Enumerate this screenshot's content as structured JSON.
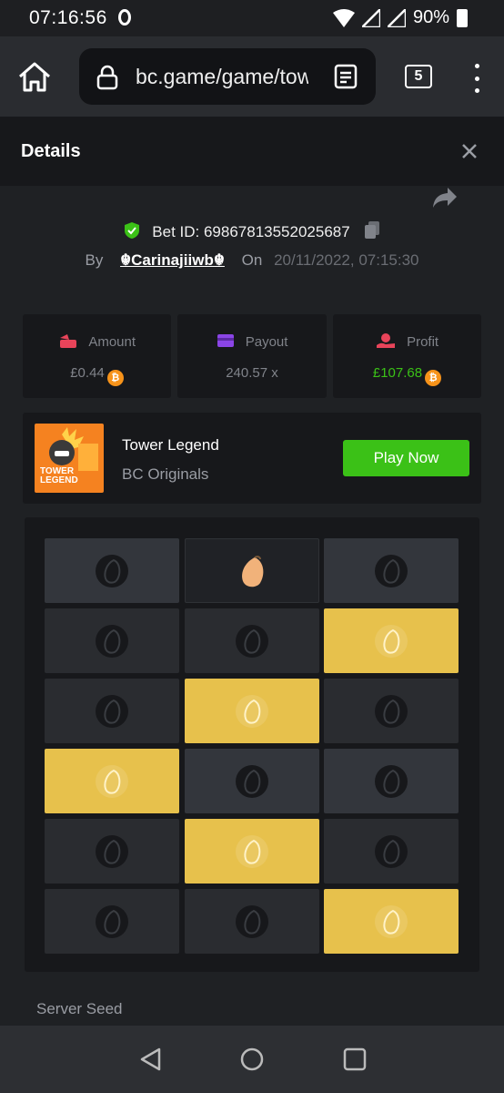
{
  "status_bar": {
    "time": "07:16:56",
    "battery": "90%"
  },
  "browser": {
    "url": "bc.game/game/tow",
    "tab_count": "5"
  },
  "modal": {
    "title": "Details"
  },
  "bet": {
    "bet_id_label": "Bet ID: 69867813552025687",
    "by_label": "By",
    "username": "☬Carinajiiwb☬",
    "on_label": "On",
    "date": "20/11/2022, 07:15:30"
  },
  "stats": {
    "amount": {
      "label": "Amount",
      "value": "£0.44"
    },
    "payout": {
      "label": "Payout",
      "value": "240.57 x"
    },
    "profit": {
      "label": "Profit",
      "value": "£107.68"
    }
  },
  "game": {
    "name": "Tower Legend",
    "provider": "BC Originals",
    "thumb_text": "TOWER LEGEND",
    "play_label": "Play Now"
  },
  "board": {
    "rows": [
      [
        "dark-alt",
        "reveal",
        "dark-alt"
      ],
      [
        "dark",
        "dark",
        "gold"
      ],
      [
        "dark",
        "gold",
        "dark"
      ],
      [
        "gold",
        "dark-alt",
        "dark-alt"
      ],
      [
        "dark",
        "gold",
        "dark"
      ],
      [
        "dark",
        "dark",
        "gold"
      ]
    ]
  },
  "section": {
    "server_seed_label": "Server Seed"
  },
  "colors": {
    "accent_green": "#3bc117",
    "gold": "#e7c14c",
    "coin": "#f7931a"
  }
}
